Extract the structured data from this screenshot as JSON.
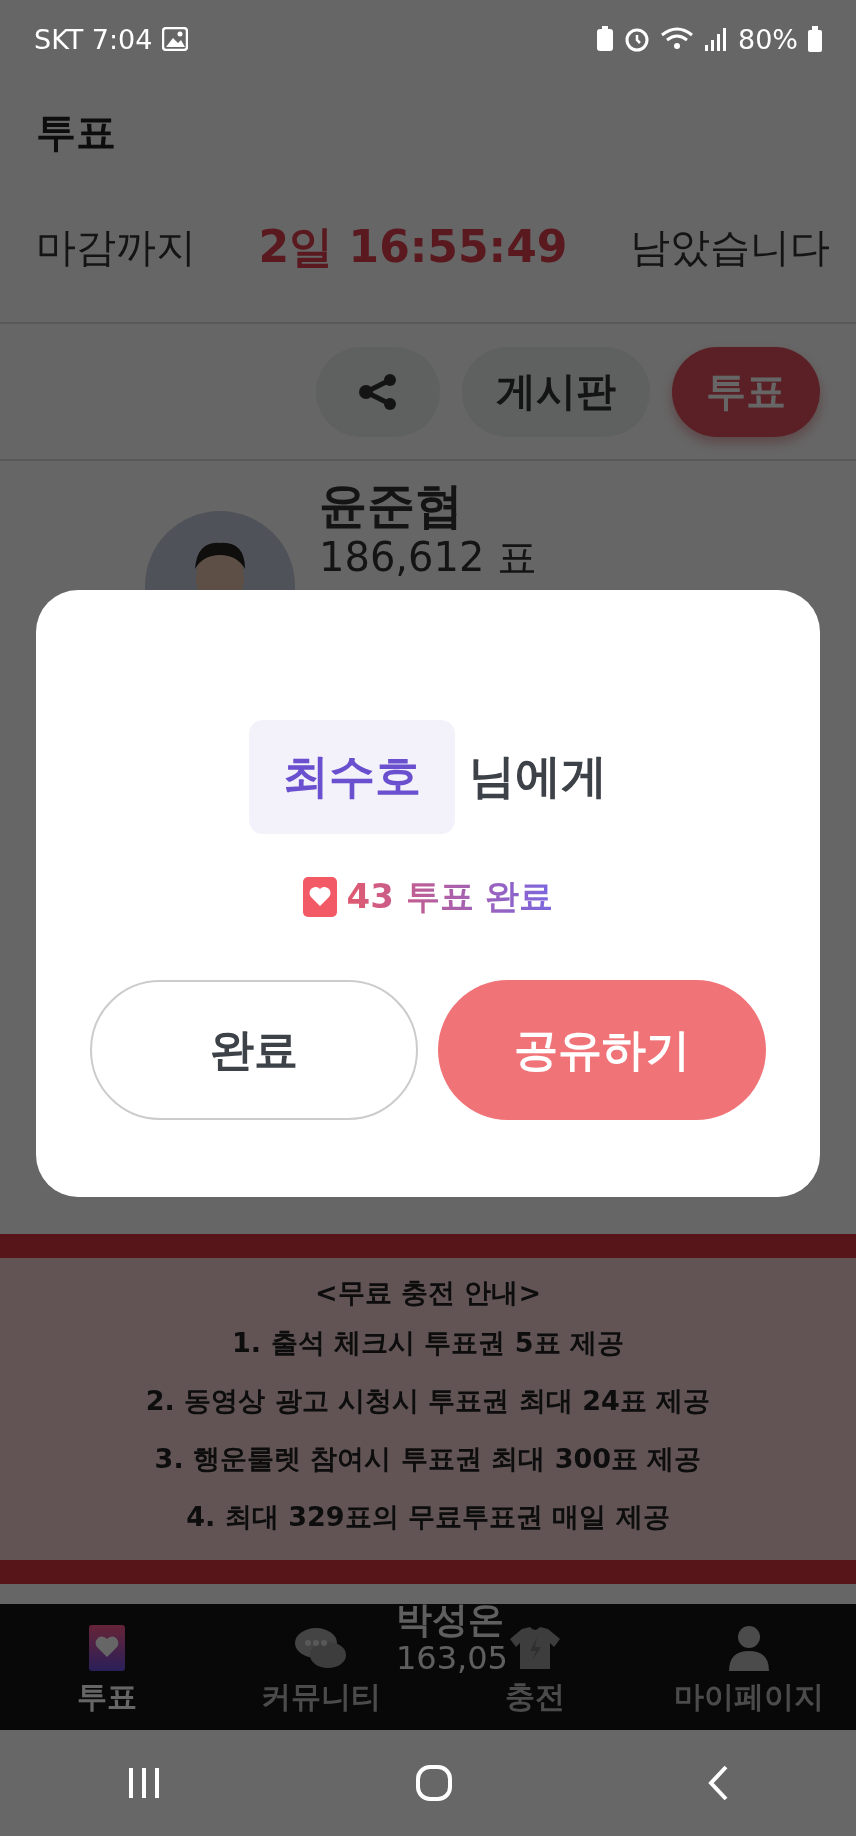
{
  "status_bar": {
    "carrier": "SKT",
    "time": "7:04",
    "battery": "80%"
  },
  "header": {
    "title": "투표"
  },
  "countdown": {
    "prefix": "마감까지",
    "remaining": "2일 16:55:49",
    "suffix": "남았습니다"
  },
  "actions": [
    {
      "kind": "share"
    },
    {
      "kind": "tab",
      "label": "게시판",
      "selected": false
    },
    {
      "kind": "tab",
      "label": "투표",
      "selected": true
    }
  ],
  "candidates": [
    {
      "name": "윤준협",
      "votes": "186,612 표"
    },
    {
      "name": "박성온",
      "votes": "163,05"
    }
  ],
  "banner": {
    "title": "<무료 충전 안내>",
    "lines": [
      "1. 출석 체크시 투표권 5표 제공",
      "2. 동영상 광고 시청시 투표권 최대 24표 제공",
      "3. 행운룰렛 참여시 투표권 최대 300표 제공",
      "4. 최대 329표의 무료투표권 매일 제공"
    ]
  },
  "bottom_nav": [
    {
      "kind": "vote",
      "label": "투표",
      "selected": true
    },
    {
      "kind": "community",
      "label": "커뮤니티",
      "selected": false
    },
    {
      "kind": "charge",
      "label": "충전",
      "selected": false
    },
    {
      "kind": "mypage",
      "label": "마이페이지",
      "selected": false
    }
  ],
  "dialog": {
    "recipient": "최수호",
    "recipient_suffix": "님에게",
    "result": "43 투표 완료",
    "buttons": [
      {
        "kind": "secondary",
        "label": "완료"
      },
      {
        "kind": "primary",
        "label": "공유하기"
      }
    ]
  }
}
